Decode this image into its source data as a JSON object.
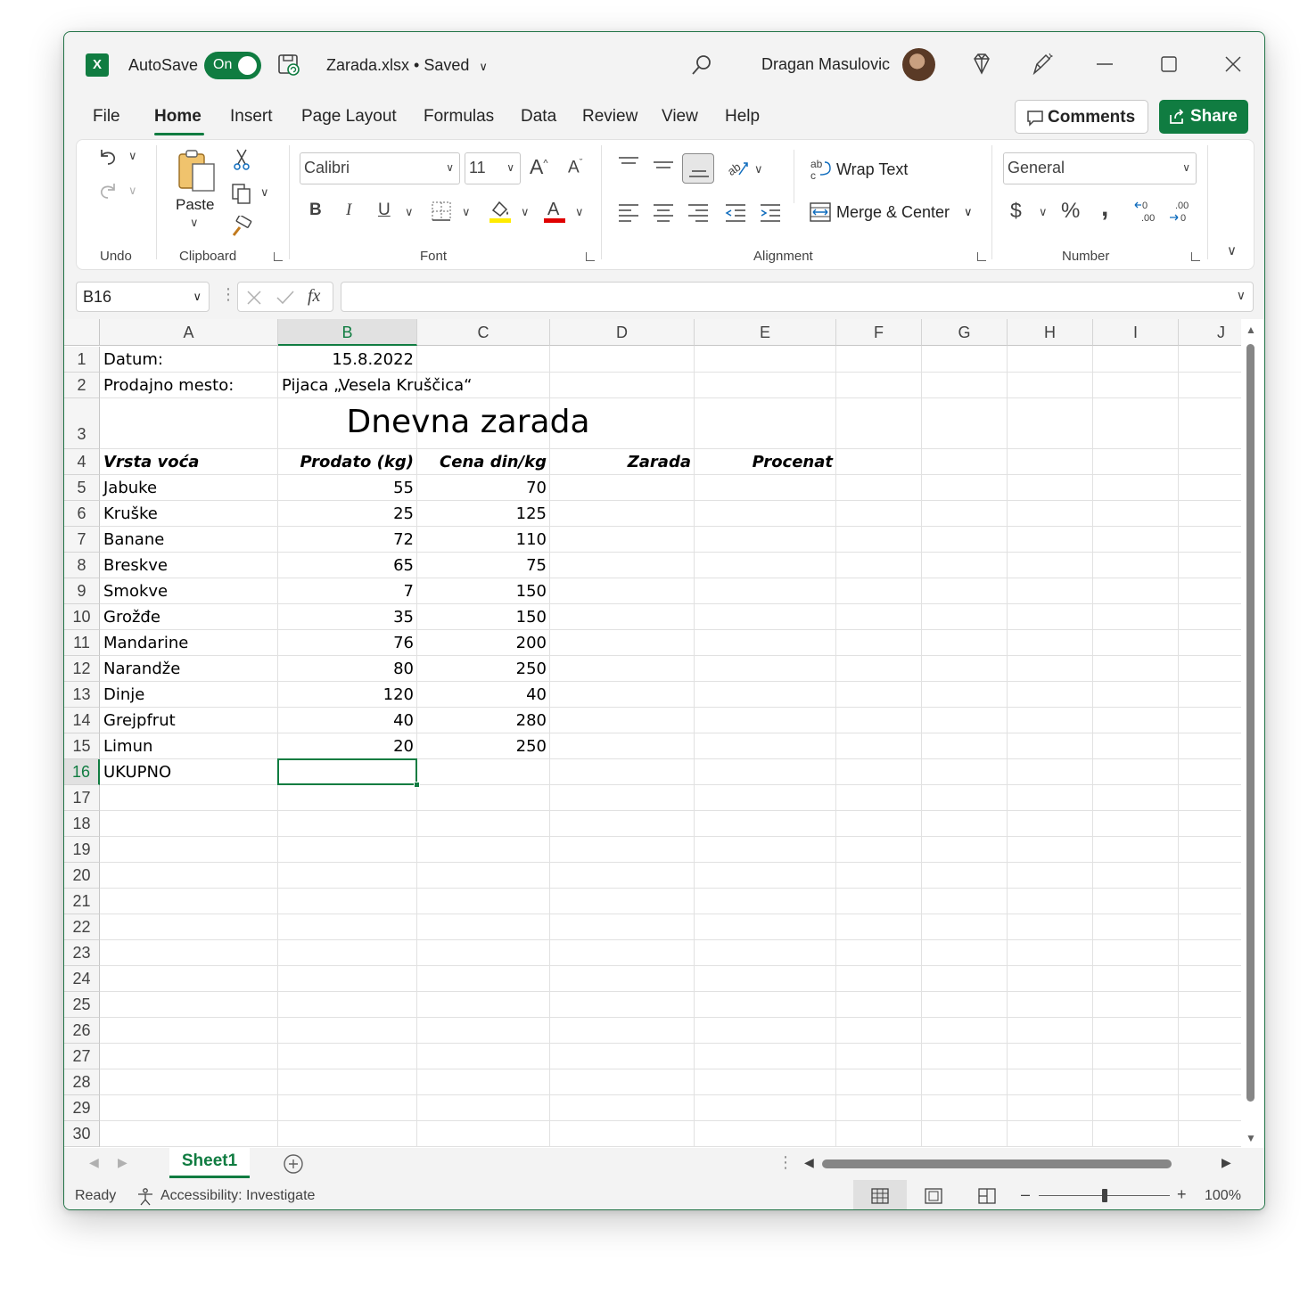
{
  "titlebar": {
    "app_logo": "X",
    "autosave_label": "AutoSave",
    "autosave_state": "On",
    "filename": "Zarada.xlsx • Saved",
    "username": "Dragan Masulovic"
  },
  "menu": {
    "tabs": [
      "File",
      "Home",
      "Insert",
      "Page Layout",
      "Formulas",
      "Data",
      "Review",
      "View",
      "Help"
    ],
    "active_tab": "Home",
    "comments_label": "Comments",
    "share_label": "Share"
  },
  "ribbon": {
    "groups": {
      "undo": "Undo",
      "clipboard": "Clipboard",
      "font": "Font",
      "alignment": "Alignment",
      "number": "Number"
    },
    "paste_label": "Paste",
    "font_name": "Calibri",
    "font_size": "11",
    "wrap_text": "Wrap Text",
    "merge_center": "Merge & Center",
    "number_format": "General",
    "bold": "B",
    "italic": "I",
    "underline": "U"
  },
  "formula_bar": {
    "name_box": "B16",
    "fx": "fx",
    "formula": ""
  },
  "grid": {
    "columns": [
      "A",
      "B",
      "C",
      "D",
      "E",
      "F",
      "G",
      "H",
      "I",
      "J"
    ],
    "selected_column": "B",
    "selected_row": 16,
    "rows": [
      "1",
      "2",
      "3",
      "4",
      "5",
      "6",
      "7",
      "8",
      "9",
      "10",
      "11",
      "12",
      "13",
      "14",
      "15",
      "16",
      "17",
      "18",
      "19",
      "20",
      "21",
      "22",
      "23",
      "24",
      "25",
      "26",
      "27",
      "28",
      "29",
      "30"
    ],
    "cells": {
      "A1": "Datum:",
      "B1": "15.8.2022",
      "A2": "Prodajno mesto:",
      "B2": "Pijaca „Vesela Kruščica“",
      "title": "Dnevna zarada",
      "A4": "Vrsta voća",
      "B4": "Prodato (kg)",
      "C4": "Cena din/kg",
      "D4": "Zarada",
      "E4": "Procenat",
      "A16": "UKUPNO"
    },
    "fruit_rows": [
      {
        "name": "Jabuke",
        "kg": "55",
        "price": "70"
      },
      {
        "name": "Kruške",
        "kg": "25",
        "price": "125"
      },
      {
        "name": "Banane",
        "kg": "72",
        "price": "110"
      },
      {
        "name": "Breskve",
        "kg": "65",
        "price": "75"
      },
      {
        "name": "Smokve",
        "kg": "7",
        "price": "150"
      },
      {
        "name": "Grožđe",
        "kg": "35",
        "price": "150"
      },
      {
        "name": "Mandarine",
        "kg": "76",
        "price": "200"
      },
      {
        "name": "Narandže",
        "kg": "80",
        "price": "250"
      },
      {
        "name": "Dinje",
        "kg": "120",
        "price": "40"
      },
      {
        "name": "Grejpfrut",
        "kg": "40",
        "price": "280"
      },
      {
        "name": "Limun",
        "kg": "20",
        "price": "250"
      }
    ]
  },
  "sheets": {
    "tabs": [
      "Sheet1"
    ],
    "active": "Sheet1"
  },
  "status": {
    "ready": "Ready",
    "accessibility": "Accessibility: Investigate",
    "zoom": "100%",
    "zoom_level": 0.5
  },
  "colors": {
    "accent": "#107c41",
    "window_border": "#217346"
  }
}
